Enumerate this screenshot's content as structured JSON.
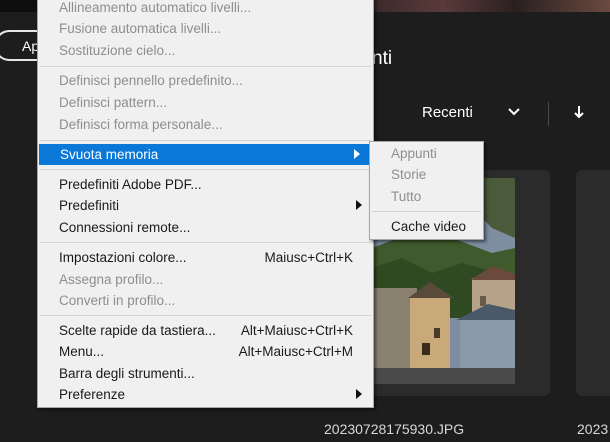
{
  "app": {
    "apri_button": "Apri",
    "section_title": "nti",
    "sort_label": "Recenti",
    "files": [
      "20230728175930.JPG",
      "2023"
    ]
  },
  "menu": {
    "items": [
      {
        "label": "Allineamento automatico livelli...",
        "shortcut": "",
        "disabled": true
      },
      {
        "label": "Fusione automatica livelli...",
        "shortcut": "",
        "disabled": true
      },
      {
        "label": "Sostituzione cielo...",
        "shortcut": "",
        "disabled": true
      },
      {
        "label": "Definisci pennello predefinito...",
        "shortcut": "",
        "disabled": true
      },
      {
        "label": "Definisci pattern...",
        "shortcut": "",
        "disabled": true
      },
      {
        "label": "Definisci forma personale...",
        "shortcut": "",
        "disabled": true
      },
      {
        "label": "Svuota memoria",
        "shortcut": "",
        "disabled": false,
        "submenu": true,
        "highlighted": true
      },
      {
        "label": "Predefiniti Adobe PDF...",
        "shortcut": "",
        "disabled": false
      },
      {
        "label": "Predefiniti",
        "shortcut": "",
        "disabled": false,
        "submenu": true
      },
      {
        "label": "Connessioni remote...",
        "shortcut": "",
        "disabled": false
      },
      {
        "label": "Impostazioni colore...",
        "shortcut": "Maiusc+Ctrl+K",
        "disabled": false
      },
      {
        "label": "Assegna profilo...",
        "shortcut": "",
        "disabled": true
      },
      {
        "label": "Converti in profilo...",
        "shortcut": "",
        "disabled": true
      },
      {
        "label": "Scelte rapide da tastiera...",
        "shortcut": "Alt+Maiusc+Ctrl+K",
        "disabled": false
      },
      {
        "label": "Menu...",
        "shortcut": "Alt+Maiusc+Ctrl+M",
        "disabled": false
      },
      {
        "label": "Barra degli strumenti...",
        "shortcut": "",
        "disabled": false
      },
      {
        "label": "Preferenze",
        "shortcut": "",
        "disabled": false,
        "submenu": true
      }
    ]
  },
  "submenu": {
    "items": [
      {
        "label": "Appunti",
        "disabled": true
      },
      {
        "label": "Storie",
        "disabled": true
      },
      {
        "label": "Tutto",
        "disabled": true
      },
      {
        "label": "Cache video",
        "disabled": false
      }
    ]
  },
  "colors": {
    "highlight": "#0a78d7",
    "background": "#1d1d1d",
    "menu_bg": "#f0f0f0",
    "disabled_text": "#8e8e8e"
  }
}
